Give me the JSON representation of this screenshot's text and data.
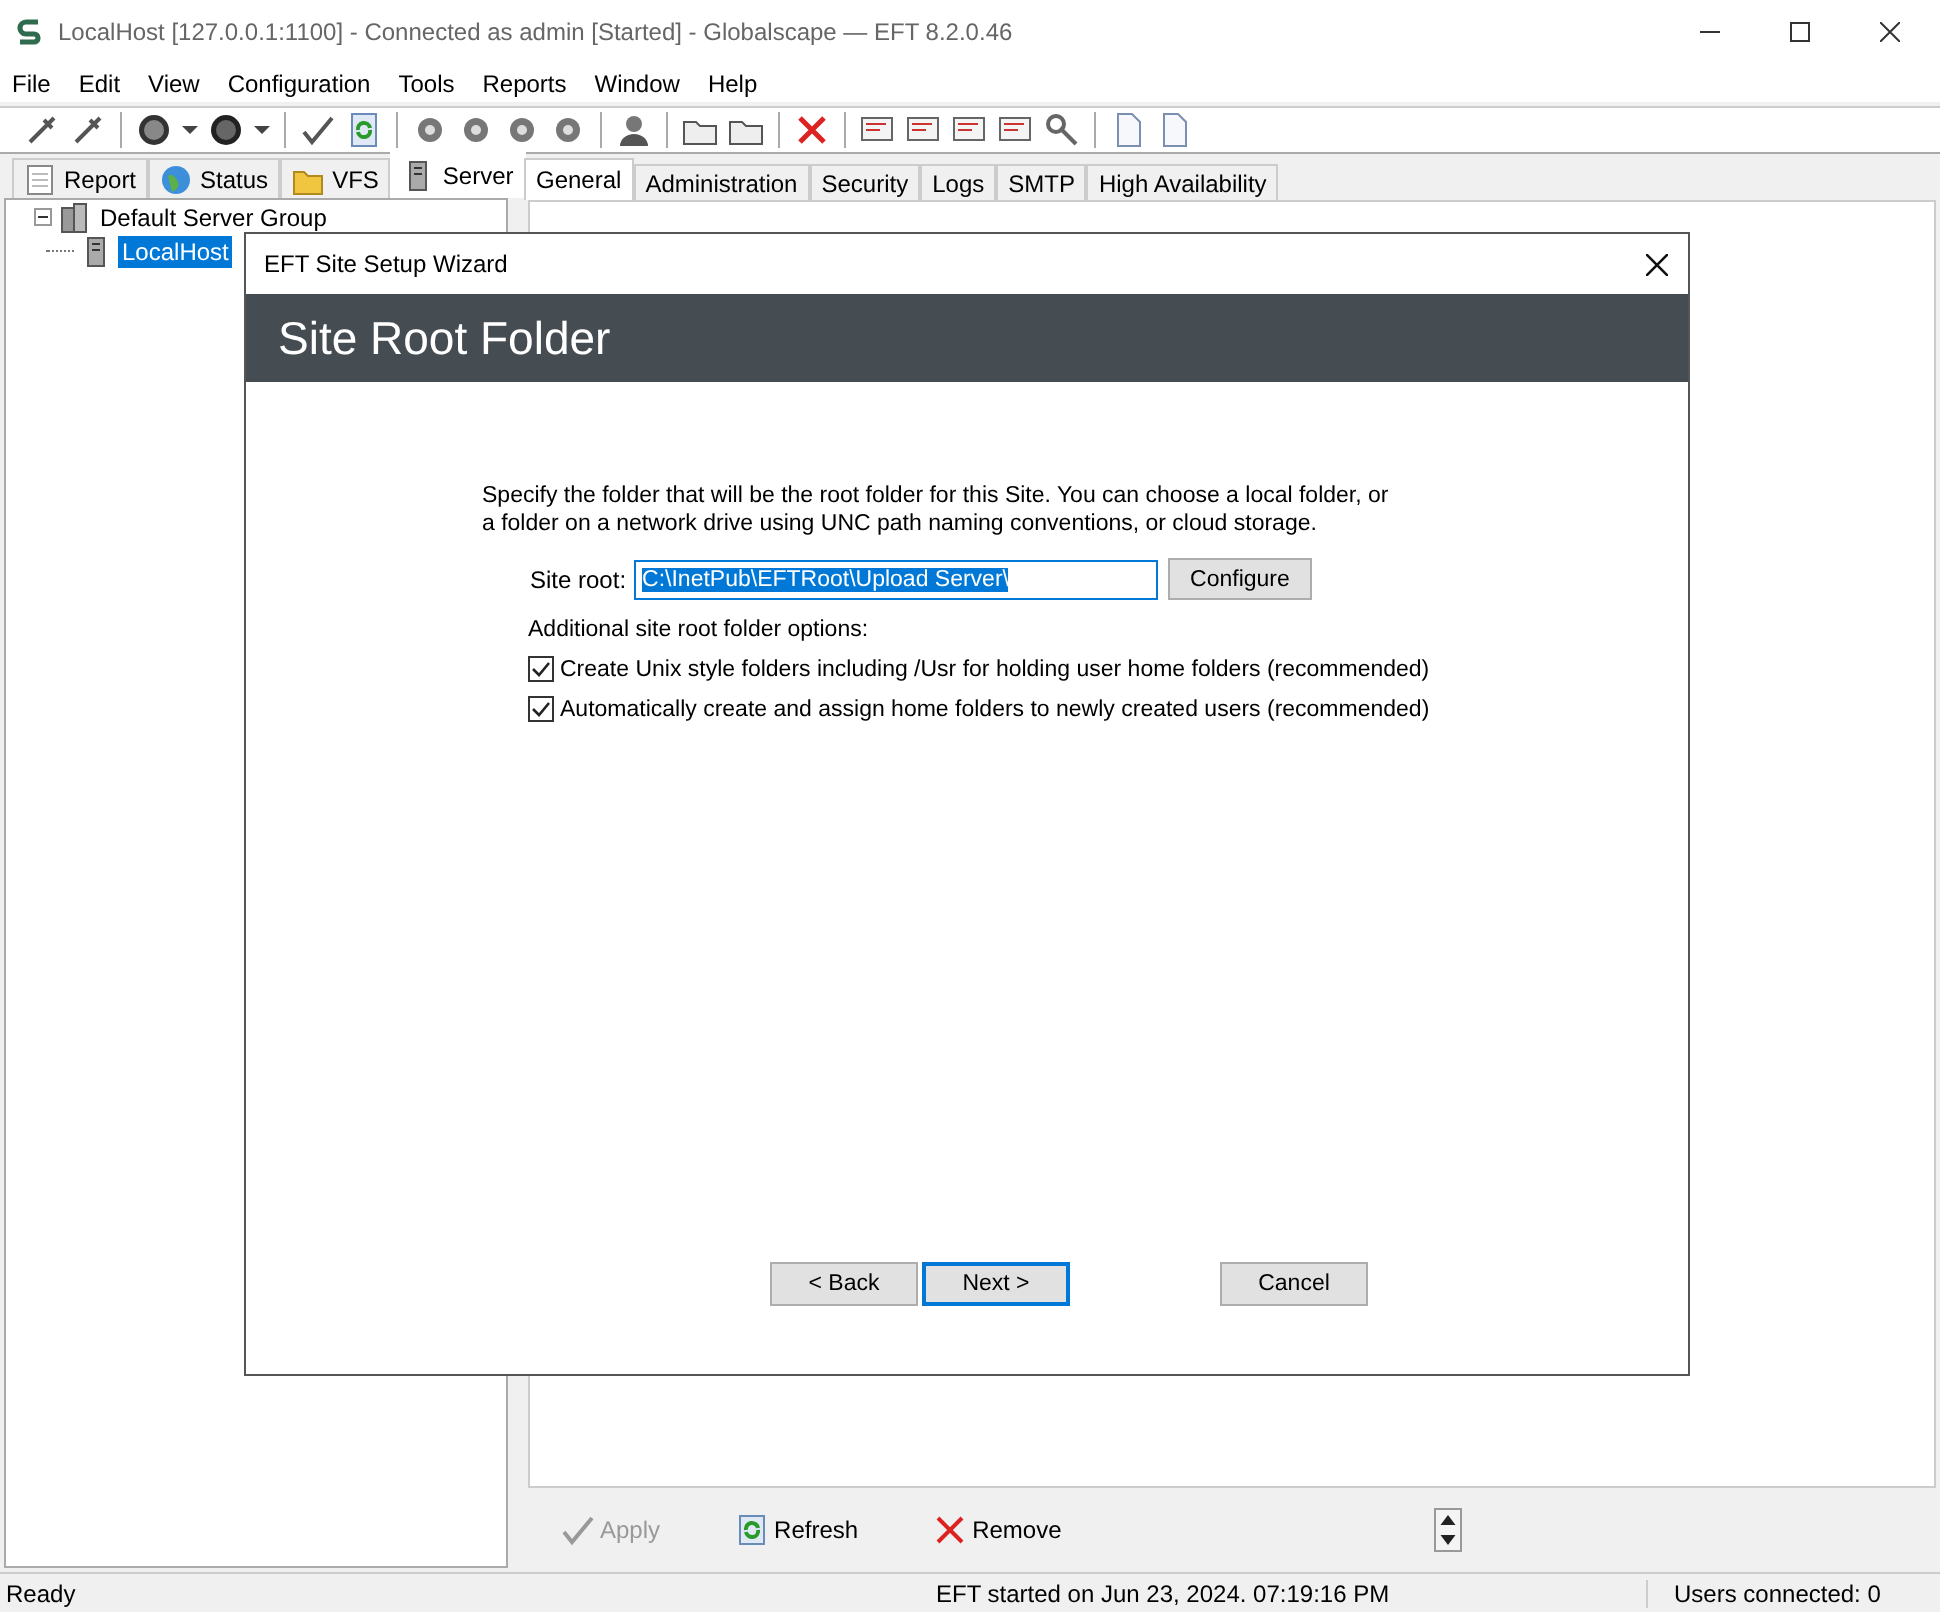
{
  "window": {
    "title": "LocalHost [127.0.0.1:1100] - Connected as admin [Started] - Globalscape — EFT 8.2.0.46"
  },
  "menu": [
    "File",
    "Edit",
    "View",
    "Configuration",
    "Tools",
    "Reports",
    "Window",
    "Help"
  ],
  "left_tabs": [
    {
      "label": "Report",
      "selected": false
    },
    {
      "label": "Status",
      "selected": false
    },
    {
      "label": "VFS",
      "selected": false
    },
    {
      "label": "Server",
      "selected": true
    }
  ],
  "tree": [
    {
      "label": "Default Server Group",
      "expanded": true,
      "selected": false,
      "children": [
        {
          "label": "LocalHost",
          "selected": true
        }
      ]
    }
  ],
  "right_tabs": [
    {
      "label": "General",
      "selected": true
    },
    {
      "label": "Administration",
      "selected": false
    },
    {
      "label": "Security",
      "selected": false
    },
    {
      "label": "Logs",
      "selected": false
    },
    {
      "label": "SMTP",
      "selected": false
    },
    {
      "label": "High Availability",
      "selected": false
    }
  ],
  "actions": [
    {
      "label": "Apply",
      "kind": "apply",
      "disabled": true
    },
    {
      "label": "Refresh",
      "kind": "refresh",
      "disabled": false
    },
    {
      "label": "Remove",
      "kind": "remove",
      "disabled": false
    }
  ],
  "status_bar": {
    "left": "Ready",
    "center": "EFT started on Jun 23, 2024. 07:19:16 PM",
    "right": "Users connected: 0"
  },
  "dialog": {
    "title": "EFT Site Setup Wizard",
    "heading": "Site Root Folder",
    "description": "Specify the folder that will be the root folder for this Site. You can choose a local folder, or a folder on a network drive using UNC path naming conventions, or cloud storage.",
    "site_root_label": "Site root:",
    "site_root_value": "C:\\InetPub\\EFTRoot\\Upload Server\\",
    "configure": "Configure",
    "options_label": "Additional site root folder options:",
    "options": [
      {
        "label": "Create Unix style folders including /Usr for holding user home folders (recommended)",
        "checked": true
      },
      {
        "label": "Automatically create and assign home folders to newly created users (recommended)",
        "checked": true
      }
    ],
    "buttons": [
      {
        "label": "< Back",
        "kind": "back"
      },
      {
        "label": "Next >",
        "kind": "next"
      },
      {
        "label": "Cancel",
        "kind": "cancel"
      }
    ]
  }
}
